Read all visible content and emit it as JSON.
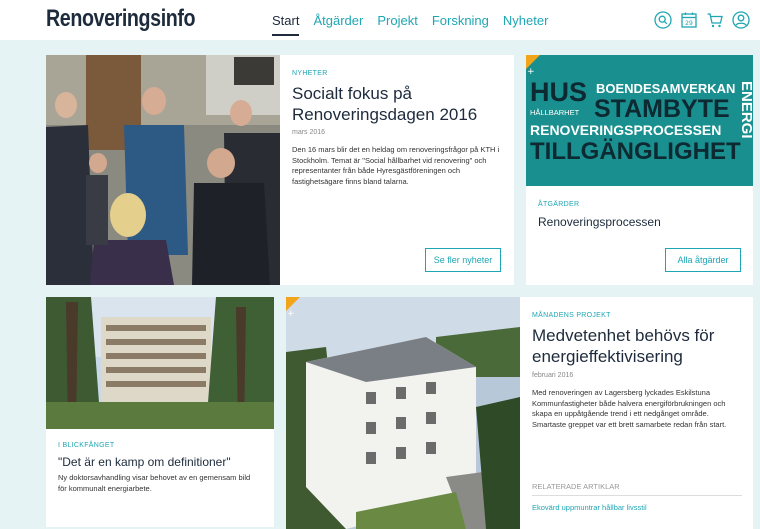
{
  "header": {
    "logo": "Renoveringsinfo",
    "nav": [
      "Start",
      "Åtgärder",
      "Projekt",
      "Forskning",
      "Nyheter"
    ],
    "calendar_day": "29"
  },
  "news": {
    "kicker": "NYHETER",
    "title": "Socialt fokus på Renoveringsdagen 2016",
    "date": "mars 2016",
    "body": "Den 16 mars blir det en heldag om renoveringsfrågor på KTH i Stockholm. Temat är \"Social hållbarhet vid renovering\" och representanter från både Hyresgästföreningen och fastighetsägare finns bland talarna.",
    "button": "Se fler nyheter"
  },
  "measures": {
    "words": [
      "HUS",
      "BOENDESAMVERKAN",
      "HÅLLBARHET",
      "STAMBYTE",
      "RENOVERINGSPROCESSEN",
      "TILLGÄNGLIGHET",
      "ENERGI"
    ],
    "kicker": "ÅTGÄRDER",
    "title": "Renoveringsprocessen",
    "button": "Alla åtgärder"
  },
  "focus": {
    "kicker": "I BLICKFÅNGET",
    "title": "\"Det är en kamp om definitioner\"",
    "body": "Ny doktorsavhandling visar behovet av en gemensam bild för kommunalt energiarbete."
  },
  "project": {
    "kicker": "MÅNADENS PROJEKT",
    "title": "Medvetenhet behövs för energieffektivisering",
    "date": "februari 2016",
    "body": "Med renoveringen av Lagersberg lyckades Eskilstuna Kommunfastigheter både halvera energiförbrukningen och skapa en uppåtgående trend i ett nedgånget område. Smartaste greppet var ett brett samarbete redan från start.",
    "related_heading": "RELATERADE ARTIKLAR",
    "related_link": "Ekovärd uppmuntrar hållbar livsstil"
  },
  "colors": {
    "accent": "#1fa6b4",
    "dark": "#1d2b3c",
    "background": "#e6f3f4",
    "badge": "#f2a51a"
  }
}
